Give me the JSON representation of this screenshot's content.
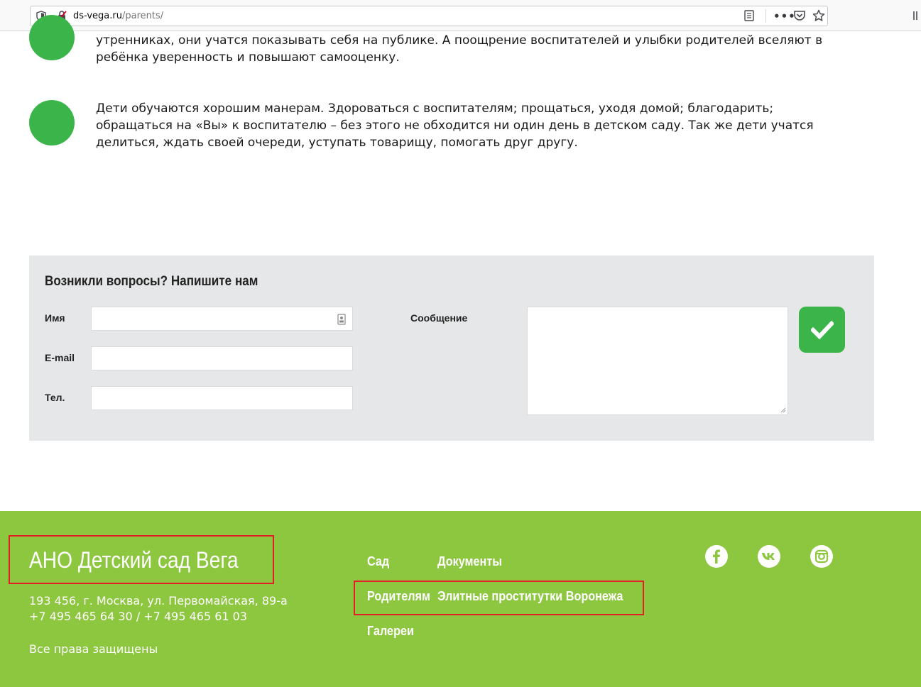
{
  "browser": {
    "url_host": "ds-vega.ru",
    "url_path": "/parents/"
  },
  "items": [
    "утренниках, они учатся показывать себя на публике. А поощрение воспитателей и улыбки родителей вселяют в ребёнка уверенность и повышают самооценку.",
    "Дети обучаются хорошим манерам. Здороваться с воспитателям; прощаться, уходя домой; благодарить; обращаться на «Вы» к воспитателю – без этого не обходится ни один день в детском саду. Так же дети учатся делиться, ждать своей очереди, уступать товарищу, помогать друг другу."
  ],
  "form": {
    "title": "Возникли вопросы? Напишите нам",
    "name_label": "Имя",
    "email_label": "E-mail",
    "phone_label": "Тел.",
    "message_label": "Сообщение"
  },
  "footer": {
    "brand": "АНО Детский сад Вега",
    "address": "193 456, г. Москва, ул. Первомайская, 89-а",
    "phones": "+7 495 465 64 30 / +7 495 465 61 03",
    "rights": "Все права защищены",
    "nav": {
      "garden": "Сад",
      "documents": "Документы",
      "parents": "Родителям",
      "ad_link": "Элитные проститутки Воронежа",
      "galleries": "Галереи"
    },
    "social": [
      "facebook-icon",
      "vk-icon",
      "instagram-icon"
    ]
  },
  "colors": {
    "accent_green": "#3bb54a",
    "footer_green": "#8dc63f",
    "highlight_red": "#e31e24",
    "form_bg": "#e6e7e8"
  }
}
